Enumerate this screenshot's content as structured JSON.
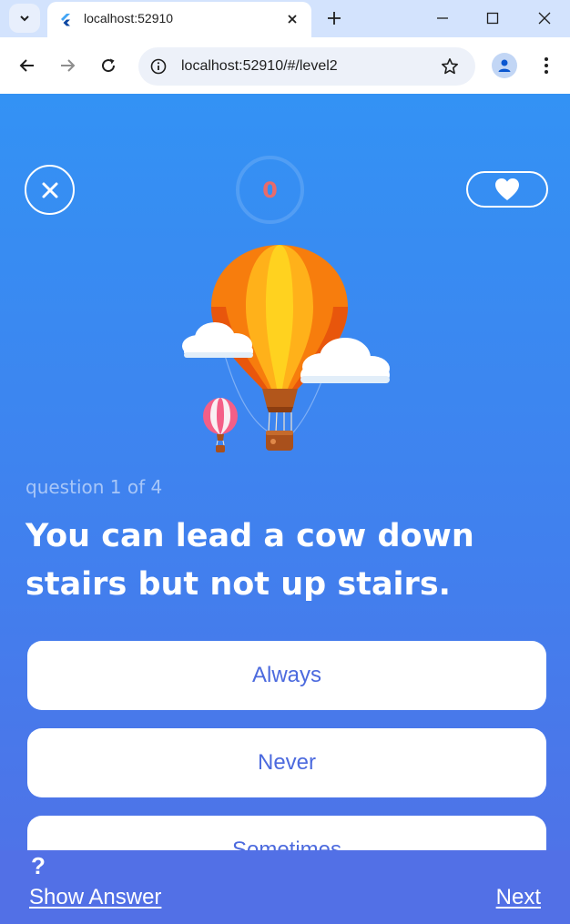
{
  "browser": {
    "tab_title": "localhost:52910",
    "url": "localhost:52910/#/level2",
    "icons": {
      "tab_list": "chevron-down-icon",
      "favicon": "flutter-icon",
      "tab_close": "close-icon",
      "new_tab": "plus-icon",
      "minimize": "minimize-icon",
      "maximize": "maximize-icon",
      "window_close": "close-icon",
      "back": "arrow-left-icon",
      "forward": "arrow-right-icon",
      "reload": "reload-icon",
      "site_info": "info-icon",
      "bookmark": "star-icon",
      "profile": "person-icon",
      "menu": "more-vert-icon"
    }
  },
  "app": {
    "score": "0",
    "question_counter": "question 1 of 4",
    "question": "You can lead a cow down stairs but not up stairs.",
    "answers": [
      "Always",
      "Never",
      "Sometimes"
    ],
    "help_symbol": "?",
    "show_answer_label": "Show Answer",
    "next_label": "Next",
    "colors": {
      "gradient_top": "#3392f4",
      "gradient_bottom": "#5170e6",
      "answer_text": "#4c6ade",
      "score_text": "#e86b6b"
    }
  }
}
